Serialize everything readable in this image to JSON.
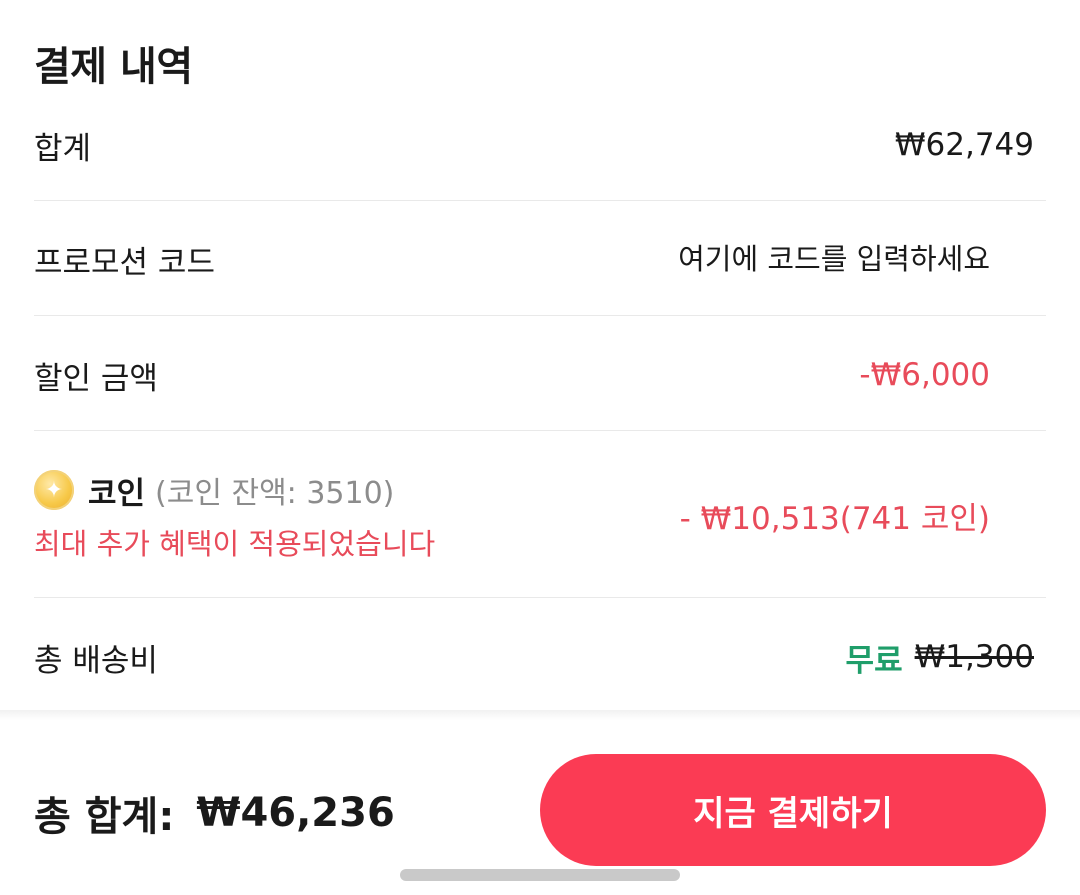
{
  "section": {
    "title": "결제 내역"
  },
  "subtotal": {
    "label": "합계",
    "value": "₩62,749"
  },
  "promo": {
    "label": "프로모션 코드",
    "placeholder": "여기에 코드를 입력하세요"
  },
  "discount": {
    "label": "할인 금액",
    "value": "-₩6,000"
  },
  "coin": {
    "icon": "coin-icon",
    "label": "코인",
    "balance": "(코인 잔액: 3510)",
    "note": "최대 추가 혜택이 적용되었습니다",
    "value": "- ₩10,513(741 코인)"
  },
  "shipping": {
    "label": "총 배송비",
    "free_label": "무료",
    "original_price": "₩1,300"
  },
  "footer": {
    "total_label": "총 합계:",
    "total_value": "₩46,236",
    "pay_button": "지금 결제하기"
  },
  "colors": {
    "accent": "#fb3b54",
    "discount": "#e84b5a",
    "free": "#1f9e6a",
    "muted": "#8c8c8c"
  }
}
